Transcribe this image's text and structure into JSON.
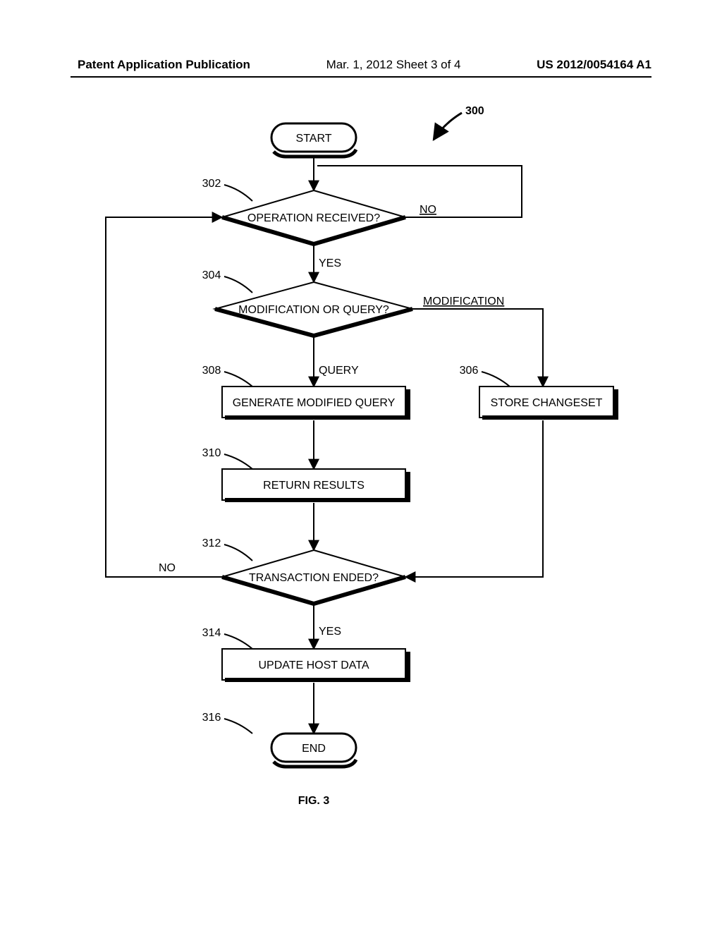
{
  "header": {
    "left": "Patent Application Publication",
    "mid": "Mar. 1, 2012  Sheet 3 of 4",
    "right": "US 2012/0054164 A1"
  },
  "figure": {
    "number": "300",
    "caption": "FIG. 3",
    "start": "START",
    "end": "END",
    "nodes": {
      "n302": {
        "ref": "302",
        "text": "OPERATION RECEIVED?"
      },
      "n304": {
        "ref": "304",
        "text": "MODIFICATION OR QUERY?"
      },
      "n306": {
        "ref": "306",
        "text": "STORE CHANGESET"
      },
      "n308": {
        "ref": "308",
        "text": "GENERATE MODIFIED QUERY"
      },
      "n310": {
        "ref": "310",
        "text": "RETURN RESULTS"
      },
      "n312": {
        "ref": "312",
        "text": "TRANSACTION ENDED?"
      },
      "n314": {
        "ref": "314",
        "text": "UPDATE HOST DATA"
      },
      "n316": {
        "ref": "316"
      }
    },
    "edges": {
      "yes": "YES",
      "no": "NO",
      "query": "QUERY",
      "modification": "MODIFICATION"
    }
  }
}
